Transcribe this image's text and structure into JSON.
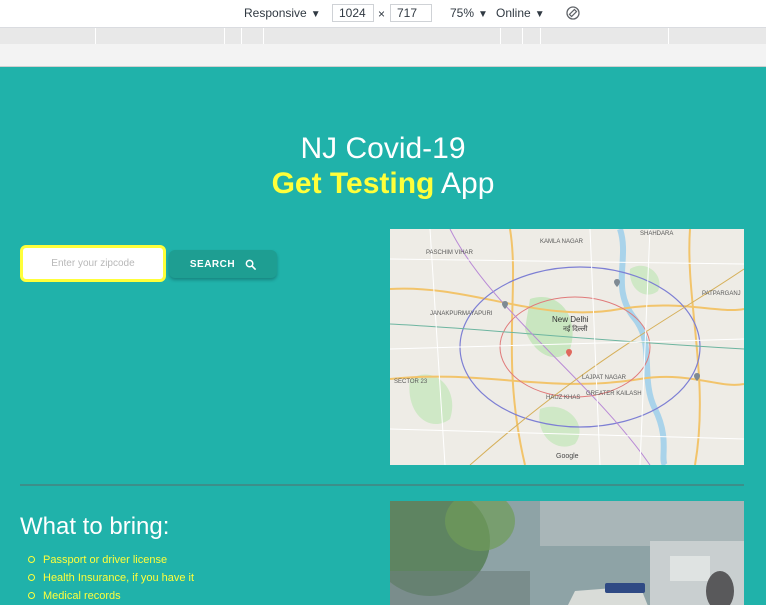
{
  "devtools": {
    "device": "Responsive",
    "width": "1024",
    "times": "×",
    "height": "717",
    "zoom": "75%",
    "network": "Online",
    "caret": "▼"
  },
  "hero": {
    "title_line1": "NJ Covid-19",
    "title_highlight": "Get Testing",
    "title_suffix": " App"
  },
  "search": {
    "placeholder": "Enter your zipcode",
    "button_label": "SEARCH"
  },
  "map": {
    "labels": [
      "KAMLA NAGAR",
      "PASCHIM VIHAR",
      "JANAKPURI",
      "MAYAPURI",
      "New Delhi",
      "नई दिल्ली",
      "PATPARGANJ",
      "SECTOR 23",
      "LAJPAT NAGAR",
      "HAUZ KHAS",
      "GREATER KAILASH",
      "SHAHDARA",
      "Google"
    ]
  },
  "bring": {
    "heading": "What to bring:",
    "items": [
      "Passport or driver license",
      "Health Insurance, if you have it",
      "Medical records"
    ]
  },
  "colors": {
    "page_bg": "#20b2aa",
    "accent_yellow": "#ffff3a",
    "button_bg": "#1e9e92"
  }
}
